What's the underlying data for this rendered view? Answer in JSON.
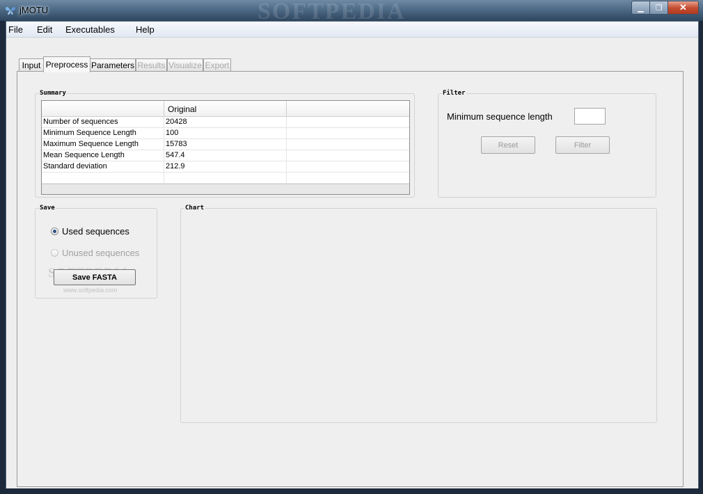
{
  "window": {
    "title": "jMOTU",
    "watermark": "SOFTPEDIA",
    "close_glyph": "✕",
    "minimize_glyph": "▁",
    "maximize_glyph": "❐"
  },
  "menu": [
    "File",
    "Edit",
    "Executables",
    "Help"
  ],
  "tabs": [
    {
      "label": "Input",
      "state": "normal"
    },
    {
      "label": "Preprocess",
      "state": "active"
    },
    {
      "label": "Parameters",
      "state": "normal"
    },
    {
      "label": "Results",
      "state": "disabled"
    },
    {
      "label": "Visualize",
      "state": "disabled"
    },
    {
      "label": "Export",
      "state": "disabled"
    }
  ],
  "summary": {
    "title": "Summary",
    "columns": [
      "",
      "Original",
      ""
    ],
    "rows": [
      [
        "Number of sequences",
        "20428"
      ],
      [
        "Minimum Sequence Length",
        "100"
      ],
      [
        "Maximum Sequence Length",
        "15783"
      ],
      [
        "Mean Sequence Length",
        "547.4"
      ],
      [
        "Standard deviation",
        "212.9"
      ],
      [
        "",
        ""
      ]
    ]
  },
  "filter": {
    "title": "Filter",
    "min_length_label": "Minimum sequence length",
    "min_length_value": "",
    "reset_label": "Reset",
    "filter_label": "Filter"
  },
  "save": {
    "title": "Save",
    "used_label": "Used sequences",
    "unused_label": "Unused sequences",
    "save_fasta_label": "Save FASTA",
    "used_selected": true,
    "watermark_text": "SOFTPEDIA",
    "watermark_url": "www.softpedia.com"
  },
  "chart": {
    "title": "Chart"
  },
  "colors": {
    "accent": "#2b4f8a",
    "title_bar": "#4d6a86",
    "close_button": "#c24a2e",
    "disabled_text": "#a8a8a8"
  }
}
